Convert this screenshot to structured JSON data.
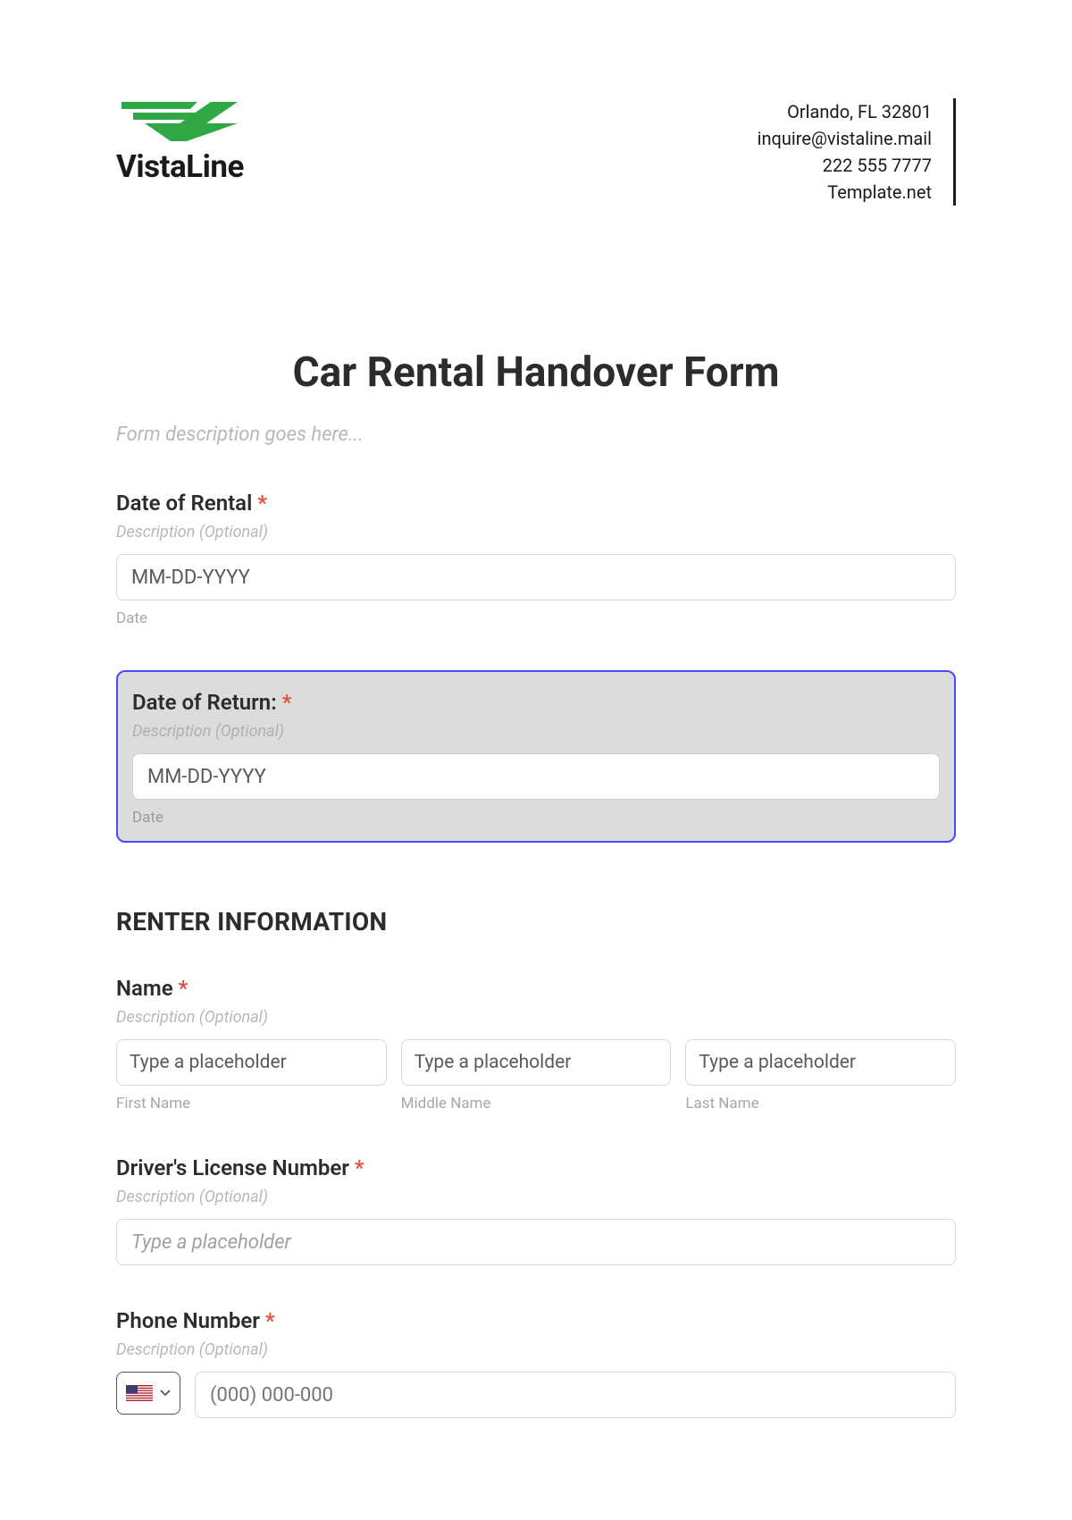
{
  "header": {
    "logo_text": "VistaLine",
    "contact": {
      "line1": "Orlando, FL 32801",
      "line2": "inquire@vistaline.mail",
      "line3": "222 555 7777",
      "line4": "Template.net"
    }
  },
  "form": {
    "title": "Car Rental Handover Form",
    "description": "Form description goes here..."
  },
  "fields": {
    "rental_date": {
      "label": "Date of Rental",
      "desc": "Description (Optional)",
      "placeholder": "MM-DD-YYYY",
      "sublabel": "Date"
    },
    "return_date": {
      "label": "Date of Return:",
      "desc": "Description (Optional)",
      "placeholder": "MM-DD-YYYY",
      "sublabel": "Date"
    },
    "section_renter": "RENTER INFORMATION",
    "name": {
      "label": "Name",
      "desc": "Description (Optional)",
      "first_placeholder": "Type a placeholder",
      "middle_placeholder": "Type a placeholder",
      "last_placeholder": "Type a placeholder",
      "first_sublabel": "First Name",
      "middle_sublabel": "Middle Name",
      "last_sublabel": "Last Name"
    },
    "license": {
      "label": "Driver's License Number",
      "desc": "Description (Optional)",
      "placeholder": "Type a placeholder"
    },
    "phone": {
      "label": "Phone Number",
      "desc": "Description (Optional)",
      "placeholder": "(000) 000-000"
    }
  },
  "required_mark": "*"
}
